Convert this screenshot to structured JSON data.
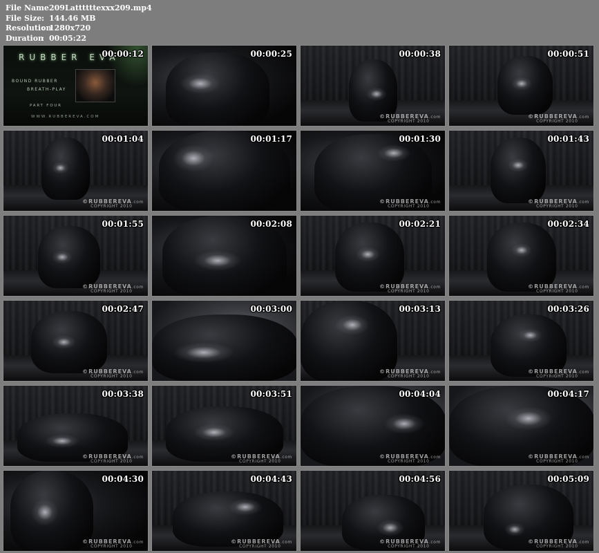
{
  "file_info": {
    "rows": [
      {
        "key": "File Name",
        "value": "209Lattttttexxx209.mp4"
      },
      {
        "key": "File Size",
        "value": "144.46 MB"
      },
      {
        "key": "Resolution",
        "value": "1280x720"
      },
      {
        "key": "Duration",
        "value": "00:05:22"
      }
    ],
    "separator": ":"
  },
  "title_card": {
    "brand": "RUBBER EVA",
    "line1": "BOUND RUBBER",
    "line2": "BREATH-PLAY",
    "part": "PART FOUR",
    "url": "WWW.RUBBEREVA.COM"
  },
  "watermark": {
    "brand": "©RUBBEREVA",
    "suffix": ".com",
    "copyright": "COPYRIGHT 2010"
  },
  "thumbnails": [
    {
      "timestamp": "00:00:12",
      "style": "title"
    },
    {
      "timestamp": "00:00:25",
      "style": "closeup"
    },
    {
      "timestamp": "00:00:38",
      "style": "curtain"
    },
    {
      "timestamp": "00:00:51",
      "style": "curtain"
    },
    {
      "timestamp": "00:01:04",
      "style": "curtain"
    },
    {
      "timestamp": "00:01:17",
      "style": "closeup"
    },
    {
      "timestamp": "00:01:30",
      "style": "closeup"
    },
    {
      "timestamp": "00:01:43",
      "style": "curtain"
    },
    {
      "timestamp": "00:01:55",
      "style": "curtain"
    },
    {
      "timestamp": "00:02:08",
      "style": "closeup"
    },
    {
      "timestamp": "00:02:21",
      "style": "curtain"
    },
    {
      "timestamp": "00:02:34",
      "style": "curtain"
    },
    {
      "timestamp": "00:02:47",
      "style": "curtain"
    },
    {
      "timestamp": "00:03:00",
      "style": "closeup-light"
    },
    {
      "timestamp": "00:03:13",
      "style": "curtain"
    },
    {
      "timestamp": "00:03:26",
      "style": "curtain"
    },
    {
      "timestamp": "00:03:38",
      "style": "curtain"
    },
    {
      "timestamp": "00:03:51",
      "style": "curtain"
    },
    {
      "timestamp": "00:04:04",
      "style": "closeup-light"
    },
    {
      "timestamp": "00:04:17",
      "style": "closeup-light"
    },
    {
      "timestamp": "00:04:30",
      "style": "closeup"
    },
    {
      "timestamp": "00:04:43",
      "style": "curtain"
    },
    {
      "timestamp": "00:04:56",
      "style": "curtain"
    },
    {
      "timestamp": "00:05:09",
      "style": "curtain"
    }
  ],
  "colors": {
    "page_background": "#7d7d7d",
    "text": "#ffffff"
  }
}
